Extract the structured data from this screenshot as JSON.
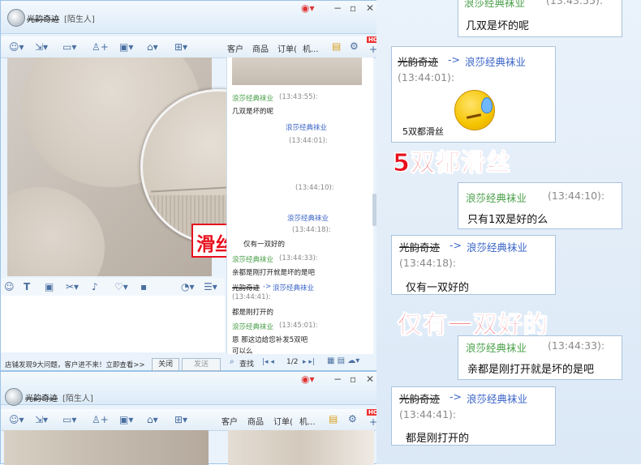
{
  "colors": {
    "accent_red": "#e8101e",
    "sender_green": "#4aa04a",
    "recipient_blue": "#3a64c8",
    "timestamp_gray": "#8a8a8a",
    "window_blue": "#eaf3fb"
  },
  "top_window": {
    "username": "光韵奇迹",
    "tag": "[陌生人]",
    "toolbar_icons": [
      "emoji-icon",
      "file-send-icon",
      "video-call-icon",
      "add-friend-icon",
      "screen-share-icon",
      "remote-assist-icon",
      "app-box-icon"
    ],
    "tabs": [
      "客户",
      "商品",
      "订单(",
      "机..."
    ],
    "hot_badge": "HOT",
    "plus_label": "+",
    "magnified_label": "滑丝",
    "input_icons": [
      "emoji-face-icon",
      "font-icon",
      "image-icon",
      "scissors-icon",
      "bell-icon",
      "heart-icon",
      "save-icon",
      "history-icon",
      "more-icon"
    ],
    "notice": "店铺发现9大问题，客户进不来！立即查看>>",
    "close_button": "关闭",
    "send_button": "发送",
    "search_label": "查找",
    "page_indicator": "1/2",
    "side_chat": [
      {
        "kind": "green",
        "text": "浪莎经典袜业",
        "ts": "(13:43:55):"
      },
      {
        "kind": "plain",
        "text": "几双是坏的呢"
      },
      {
        "kind": "sender",
        "name": "光韵奇迹",
        "to": "->",
        "store": "浪莎经典袜业"
      },
      {
        "kind": "ts",
        "text": "(13:44:01):"
      },
      {
        "kind": "ts",
        "text": "(13:44:10):"
      },
      {
        "kind": "blue",
        "text": "浪莎经典袜业"
      },
      {
        "kind": "ts",
        "text": "(13:44:18):"
      },
      {
        "kind": "plain",
        "text": "仅有一双好的"
      },
      {
        "kind": "green",
        "text": "浪莎经典袜业",
        "ts": "(13:44:33):"
      },
      {
        "kind": "plain",
        "text": "亲都是刚打开就是坏的是吧"
      },
      {
        "kind": "sender",
        "name": "光韵奇迹",
        "to": "->",
        "store": "浪莎经典袜业"
      },
      {
        "kind": "ts",
        "text": "(13:44:41):"
      },
      {
        "kind": "plain",
        "text": "都是刚打开的"
      },
      {
        "kind": "green",
        "text": "浪莎经典袜业",
        "ts": "(13:45:01):"
      },
      {
        "kind": "plain",
        "text": "恩 那这边给您补发5双吧"
      },
      {
        "kind": "plain",
        "text": "可以么"
      }
    ]
  },
  "bottom_window": {
    "username": "光韵奇迹",
    "tag": "[陌生人]",
    "tabs": [
      "客户",
      "商品",
      "订单(",
      "机..."
    ],
    "hot_badge": "HOT"
  },
  "chat": {
    "top_partial": {
      "name": "浪莎经典袜业",
      "ts": "(13:43:55):",
      "text": "几双是坏的呢"
    },
    "msg1": {
      "sender": "光韵奇迹",
      "arrow": "->",
      "store": "浪莎经典袜业",
      "ts": "(13:44:01):",
      "text": "5双都滑丝",
      "emoji": "sweat-emoji-icon"
    },
    "caption1": "5双都滑丝",
    "msg2": {
      "name": "浪莎经典袜业",
      "ts": "(13:44:10):",
      "text": "只有1双是好的么"
    },
    "msg3": {
      "sender": "光韵奇迹",
      "arrow": "->",
      "store": "浪莎经典袜业",
      "ts": "(13:44:18):",
      "text": "仅有一双好的"
    },
    "caption2": "仅有一双好的",
    "msg4": {
      "name": "浪莎经典袜业",
      "ts": "(13:44:33):",
      "text": "亲都是刚打开就是坏的是吧"
    },
    "msg5": {
      "sender": "光韵奇迹",
      "arrow": "->",
      "store": "浪莎经典袜业",
      "ts": "(13:44:41):",
      "text": "都是刚打开的"
    }
  }
}
